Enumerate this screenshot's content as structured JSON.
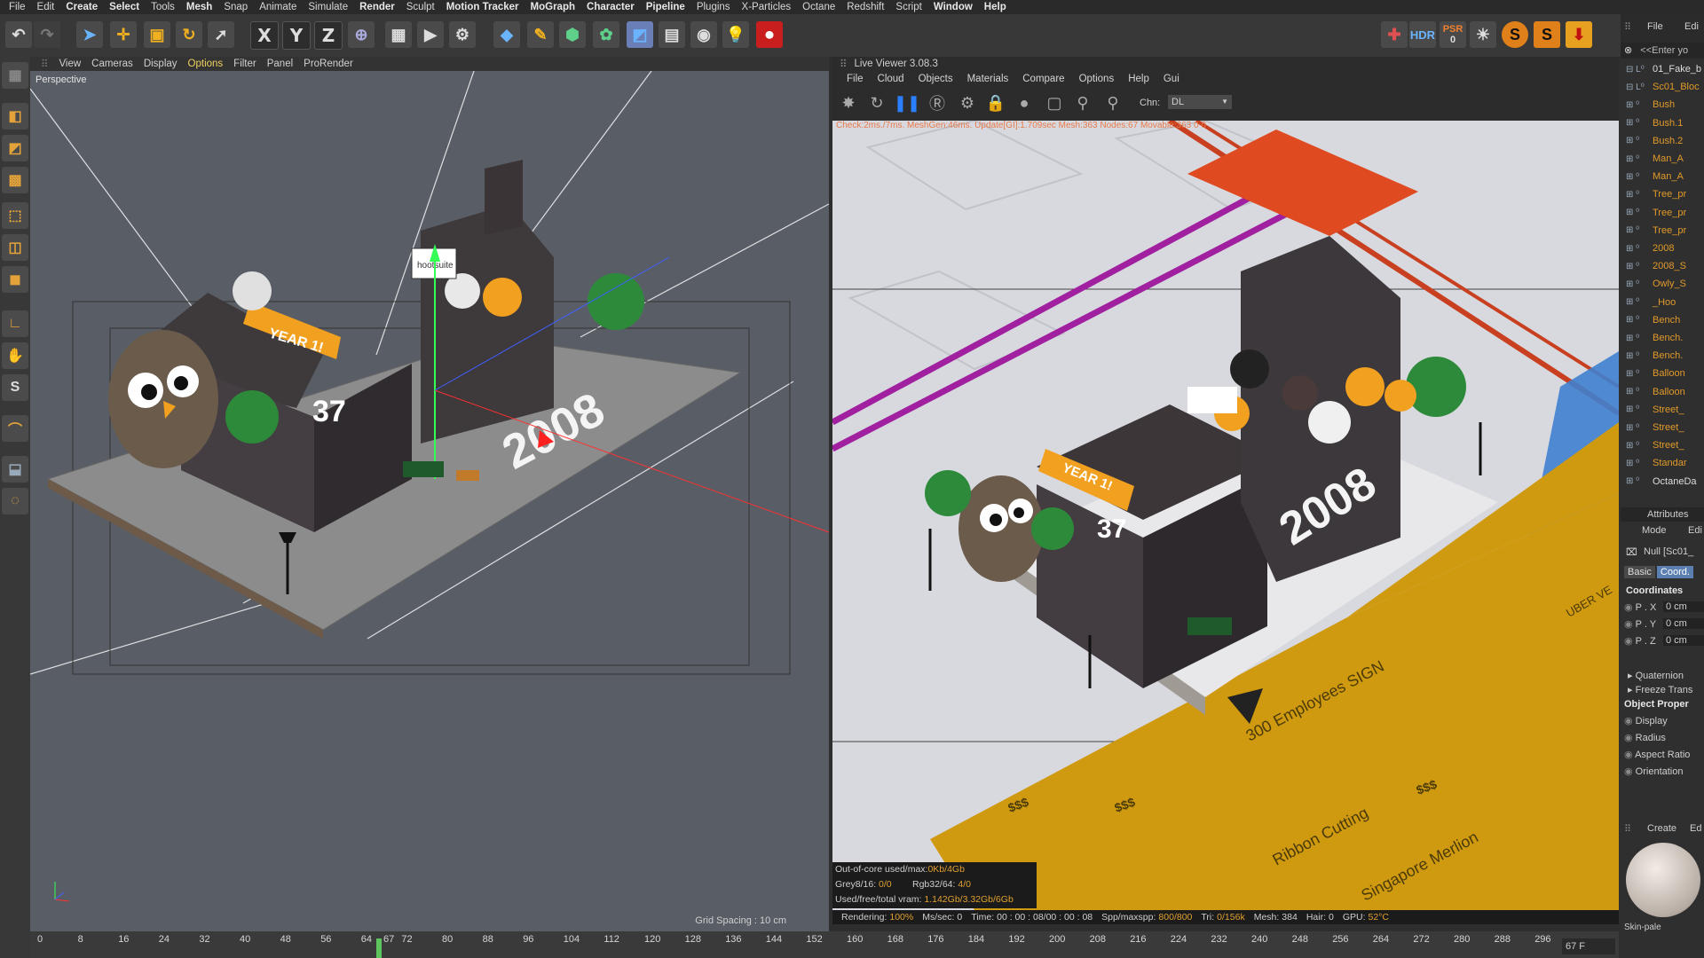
{
  "menubar": [
    "File",
    "Edit",
    "Create",
    "Select",
    "Tools",
    "Mesh",
    "Snap",
    "Animate",
    "Simulate",
    "Render",
    "Sculpt",
    "Motion Tracker",
    "MoGraph",
    "Character",
    "Pipeline",
    "Plugins",
    "X-Particles",
    "Octane",
    "Redshift",
    "Script",
    "Window",
    "Help"
  ],
  "menubar_bold": [
    "Create",
    "Select",
    "Mesh",
    "Render",
    "Motion Tracker",
    "MoGraph",
    "Character",
    "Pipeline",
    "Window",
    "Help"
  ],
  "toolbar": {
    "axis_x": "X",
    "axis_y": "Y",
    "axis_z": "Z",
    "hdr": "HDR",
    "psr": "PSR",
    "psr_value": "0"
  },
  "viewport": {
    "menu": [
      "View",
      "Cameras",
      "Display",
      "Options",
      "Filter",
      "Panel",
      "ProRender"
    ],
    "active_menu": "Options",
    "label": "Perspective",
    "grid_spacing": "Grid Spacing : 10 cm",
    "scene_texts": {
      "year": "YEAR 1!",
      "number": "37",
      "big_year": "2008",
      "hootsuite": "hootsuite"
    }
  },
  "live_viewer": {
    "title": "Live Viewer 3.08.3",
    "menu": [
      "File",
      "Cloud",
      "Objects",
      "Materials",
      "Compare",
      "Options",
      "Help",
      "Gui"
    ],
    "channel_label": "Chn:",
    "channel_value": "DL",
    "stats_line": "Check:2ms./7ms. MeshGen:46ms. Update[GI]:1.709sec Mesh:363 Nodes:67 Movable:363  0 0",
    "scene_texts": {
      "year": "YEAR 1!",
      "number": "37",
      "big_year": "2008",
      "employees": "300 Employees SIGN",
      "ribbon": "Ribbon Cutting",
      "merlion": "Singapore Merlion",
      "uber": "UBER VE",
      "money": "$$$"
    },
    "status": {
      "ooc_label": "Out-of-core used/max:",
      "ooc_value": "0Kb/4Gb",
      "grey_label": "Grey8/16:",
      "grey_value": "0/0",
      "rgb_label": "Rgb32/64:",
      "rgb_value": "4/0",
      "vram_label": "Used/free/total vram:",
      "vram_value": "1.142Gb/3.32Gb/6Gb"
    },
    "bottom": {
      "rendering_label": "Rendering:",
      "rendering_value": "100%",
      "ms_label": "Ms/sec:",
      "ms_value": "0",
      "time_label": "Time:",
      "time_value": "00 : 00 : 08/00 : 00 : 08",
      "spp_label": "Spp/maxspp:",
      "spp_value": "800/800",
      "tri_label": "Tri:",
      "tri_value": "0/156k",
      "mesh_label": "Mesh:",
      "mesh_value": "384",
      "hair_label": "Hair:",
      "hair_value": "0",
      "gpu_label": "GPU:",
      "gpu_value": "52°C"
    }
  },
  "timeline": {
    "ticks": [
      "0",
      "8",
      "16",
      "24",
      "32",
      "40",
      "48",
      "56",
      "64",
      "72",
      "80",
      "88",
      "96",
      "104",
      "112",
      "120",
      "128",
      "136",
      "144",
      "152",
      "160",
      "168",
      "176",
      "184",
      "192",
      "200",
      "208",
      "216",
      "224",
      "232",
      "240",
      "248",
      "256",
      "264",
      "272",
      "280",
      "288",
      "296"
    ],
    "playhead_label": "67",
    "frame_field": "67 F"
  },
  "object_manager": {
    "header": [
      "File",
      "Edi"
    ],
    "search_placeholder": "<<Enter yo",
    "items": [
      {
        "name": "01_Fake_b",
        "color": "white"
      },
      {
        "name": "Sc01_Bloc",
        "color": "orange"
      },
      {
        "name": "Bush",
        "color": "orange"
      },
      {
        "name": "Bush.1",
        "color": "orange"
      },
      {
        "name": "Bush.2",
        "color": "orange"
      },
      {
        "name": "Man_A",
        "color": "orange"
      },
      {
        "name": "Man_A",
        "color": "orange"
      },
      {
        "name": "Tree_pr",
        "color": "orange"
      },
      {
        "name": "Tree_pr",
        "color": "orange"
      },
      {
        "name": "Tree_pr",
        "color": "orange"
      },
      {
        "name": "2008",
        "color": "orange"
      },
      {
        "name": "2008_S",
        "color": "orange"
      },
      {
        "name": "Owly_S",
        "color": "orange"
      },
      {
        "name": "_Hoo",
        "color": "orange"
      },
      {
        "name": "Bench",
        "color": "orange"
      },
      {
        "name": "Bench.",
        "color": "orange"
      },
      {
        "name": "Bench.",
        "color": "orange"
      },
      {
        "name": "Balloon",
        "color": "orange"
      },
      {
        "name": "Balloon",
        "color": "orange"
      },
      {
        "name": "Street_",
        "color": "orange"
      },
      {
        "name": "Street_",
        "color": "orange"
      },
      {
        "name": "Street_",
        "color": "orange"
      },
      {
        "name": "Standar",
        "color": "orange"
      },
      {
        "name": "OctaneDa",
        "color": "white"
      }
    ]
  },
  "attributes": {
    "title": "Attributes",
    "mode": "Mode",
    "edit": "Edi",
    "object": "Null [Sc01_",
    "tabs": [
      "Basic",
      "Coord."
    ],
    "active_tab": "Coord.",
    "coordinates_heading": "Coordinates",
    "coords": [
      {
        "label": "P . X",
        "value": "0 cm"
      },
      {
        "label": "P . Y",
        "value": "0 cm"
      },
      {
        "label": "P . Z",
        "value": "0 cm"
      }
    ],
    "quaternion": "Quaternion",
    "freeze": "Freeze Trans",
    "object_props_heading": "Object Proper",
    "props": [
      "Display",
      "Radius",
      "Aspect Ratio",
      "Orientation"
    ]
  },
  "material": {
    "tabs": [
      "Create",
      "Ed"
    ],
    "name": "Skin-pale"
  }
}
